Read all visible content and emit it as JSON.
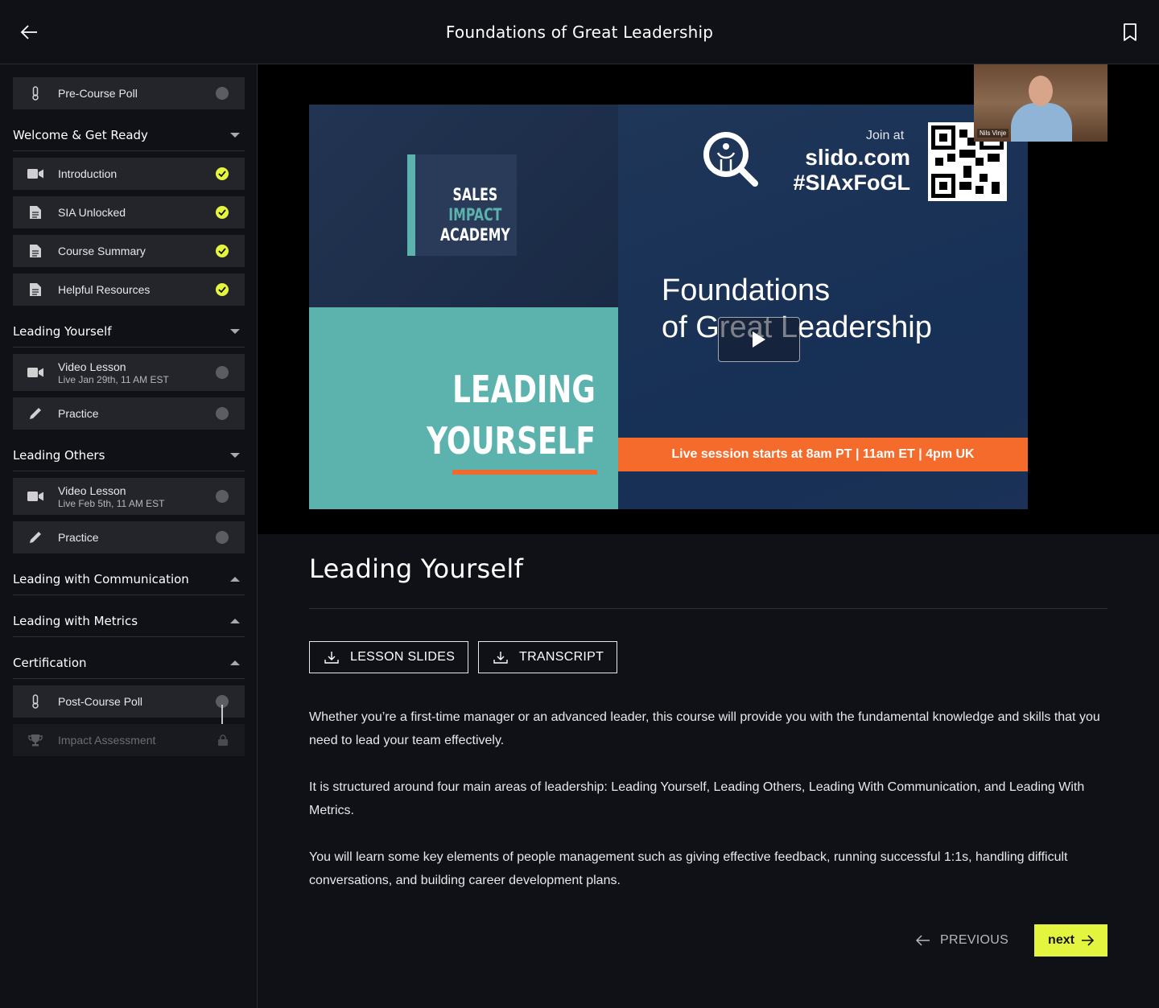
{
  "header": {
    "title": "Foundations of Great Leadership"
  },
  "sidebar": {
    "pre_poll": {
      "label": "Pre-Course Poll"
    },
    "sections": [
      {
        "title": "Welcome & Get Ready",
        "expanded": true
      },
      {
        "title": "Leading Yourself",
        "expanded": true
      },
      {
        "title": "Leading Others",
        "expanded": true
      },
      {
        "title": "Leading with Communication",
        "expanded": false
      },
      {
        "title": "Leading with Metrics",
        "expanded": false
      },
      {
        "title": "Certification",
        "expanded": false
      }
    ],
    "welcome_items": [
      {
        "label": "Introduction",
        "icon": "video-icon",
        "status": "complete"
      },
      {
        "label": "SIA Unlocked",
        "icon": "document-icon",
        "status": "complete"
      },
      {
        "label": "Course Summary",
        "icon": "document-icon",
        "status": "complete"
      },
      {
        "label": "Helpful Resources",
        "icon": "document-icon",
        "status": "complete"
      }
    ],
    "leading_yourself_items": [
      {
        "label": "Video Lesson",
        "sub": "Live Jan 29th, 11 AM EST",
        "icon": "video-icon",
        "status": "incomplete"
      },
      {
        "label": "Practice",
        "icon": "pencil-icon",
        "status": "incomplete"
      }
    ],
    "leading_others_items": [
      {
        "label": "Video Lesson",
        "sub": "Live Feb 5th, 11 AM EST",
        "icon": "video-icon",
        "status": "incomplete"
      },
      {
        "label": "Practice",
        "icon": "pencil-icon",
        "status": "incomplete"
      }
    ],
    "certification_items": [
      {
        "label": "Post-Course Poll",
        "icon": "thermometer-icon",
        "status": "incomplete"
      },
      {
        "label": "Impact Assessment",
        "icon": "trophy-icon",
        "status": "locked"
      }
    ]
  },
  "video": {
    "slide": {
      "logo_line1": "SALES",
      "logo_line2": "IMPACT",
      "logo_line3": "ACADEMY",
      "lead_line1": "LEADING",
      "lead_line2": "YOURSELF",
      "join_at": "Join at",
      "slido": "slido.com",
      "hashtag": "#SIAxFoGL",
      "title_line1": "Foundations",
      "title_line2": "of Great Leadership",
      "banner": "Live session starts at 8am PT  |  11am ET | 4pm UK"
    },
    "presenter_name": "Nils Vinje"
  },
  "lesson": {
    "title": "Leading Yourself",
    "slides_button": "LESSON SLIDES",
    "transcript_button": "TRANSCRIPT",
    "paragraphs": [
      "Whether you’re a first-time manager or an advanced leader, this course will provide you with the fundamental knowledge and skills that you need to lead your team effectively.",
      "It is structured around four main areas of leadership: Leading Yourself, Leading Others, Leading With Communication, and Leading With Metrics.",
      "You will learn some key elements of people management such as giving effective feedback, running successful 1:1s, handling difficult conversations, and building career development plans."
    ]
  },
  "nav": {
    "previous": "PREVIOUS",
    "next": "next"
  },
  "colors": {
    "accent": "#e4f53f",
    "background": "#101117",
    "item_bg": "#23252b",
    "slide_teal": "#5cb3ae",
    "slide_orange": "#f46b2c"
  }
}
